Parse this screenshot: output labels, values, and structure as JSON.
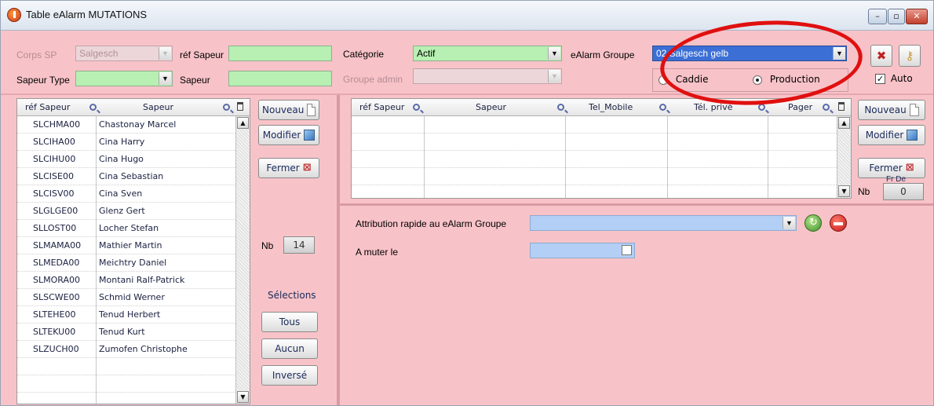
{
  "window": {
    "title": "Table eAlarm MUTATIONS",
    "controls": {
      "minimize": "–",
      "maximize": "▫",
      "close": "✕"
    }
  },
  "filters": {
    "corps_sp_label": "Corps SP",
    "corps_sp_value": "Salgesch",
    "ref_sapeur_label": "réf Sapeur",
    "ref_sapeur_value": "",
    "sapeur_type_label": "Sapeur Type",
    "sapeur_type_value": "",
    "sapeur_label": "Sapeur",
    "sapeur_value": "",
    "categorie_label": "Catégorie",
    "categorie_value": "Actif",
    "groupe_admin_label": "Groupe admin",
    "groupe_admin_value": "",
    "ealarm_groupe_label": "eAlarm Groupe",
    "ealarm_groupe_value": "02 Salgesch gelb",
    "radio_caddie": "Caddie",
    "radio_production": "Production",
    "selected_radio": "Production",
    "auto_label": "Auto",
    "auto_checked": true
  },
  "left_grid": {
    "columns": [
      "réf Sapeur",
      "Sapeur"
    ],
    "rows": [
      [
        "SLCHMA00",
        "Chastonay Marcel"
      ],
      [
        "SLCIHA00",
        "Cina Harry"
      ],
      [
        "SLCIHU00",
        "Cina Hugo"
      ],
      [
        "SLCISE00",
        "Cina Sebastian"
      ],
      [
        "SLCISV00",
        "Cina Sven"
      ],
      [
        "SLGLGE00",
        "Glenz Gert"
      ],
      [
        "SLLOST00",
        "Locher Stefan"
      ],
      [
        "SLMAMA00",
        "Mathier Martin"
      ],
      [
        "SLMEDA00",
        "Meichtry Daniel"
      ],
      [
        "SLMORA00",
        "Montani Ralf-Patrick"
      ],
      [
        "SLSCWE00",
        "Schmid Werner"
      ],
      [
        "SLTEHE00",
        "Tenud Herbert"
      ],
      [
        "SLTEKU00",
        "Tenud Kurt"
      ],
      [
        "SLZUCH00",
        "Zumofen Christophe"
      ]
    ]
  },
  "left_buttons": {
    "nouveau": "Nouveau",
    "modifier": "Modifier",
    "fermer": "Fermer",
    "nb_label": "Nb",
    "nb_value": "14",
    "selections_label": "Sélections",
    "tous": "Tous",
    "aucun": "Aucun",
    "inverse": "Inversé"
  },
  "right_grid": {
    "columns": [
      "réf Sapeur",
      "Sapeur",
      "Tel_Mobile",
      "Tél. privé",
      "Pager"
    ],
    "rows": []
  },
  "right_buttons": {
    "nouveau": "Nouveau",
    "modifier": "Modifier",
    "fermer": "Fermer",
    "fr_de": "Fr De",
    "nb_label": "Nb",
    "nb_value": "0"
  },
  "bottom_panel": {
    "attribution_label": "Attribution rapide au eAlarm Groupe",
    "attribution_value": "",
    "a_muter_label": "A muter le",
    "a_muter_value": ""
  },
  "colors": {
    "background": "#f8c3c8",
    "field_green": "#b7f0b2",
    "field_blue": "#b3cff5",
    "selected_blue": "#3b6fd6",
    "annotation_red": "#e01010"
  }
}
